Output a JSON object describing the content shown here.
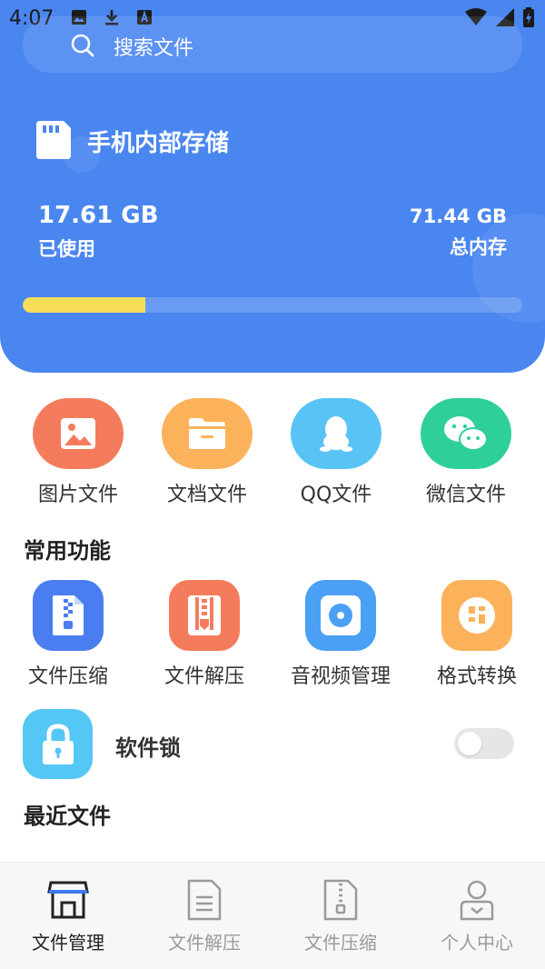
{
  "status_bar": {
    "time": "4:07"
  },
  "search": {
    "placeholder": "搜索文件"
  },
  "storage": {
    "title": "手机内部存储",
    "used_value": "17.61 GB",
    "used_label": "已使用",
    "total_value": "71.44 GB",
    "total_label": "总内存",
    "used_fraction": 0.246
  },
  "categories": [
    {
      "label": "图片文件",
      "icon": "image-icon",
      "color": "#f47c5c"
    },
    {
      "label": "文档文件",
      "icon": "folder-icon",
      "color": "#fbb25a"
    },
    {
      "label": "QQ文件",
      "icon": "penguin-icon",
      "color": "#59c3f5"
    },
    {
      "label": "微信文件",
      "icon": "wechat-icon",
      "color": "#2fcf9c"
    }
  ],
  "common_section": {
    "title": "常用功能"
  },
  "tools": [
    {
      "label": "文件压缩",
      "icon": "zip-icon",
      "color": "#4a7df0"
    },
    {
      "label": "文件解压",
      "icon": "unzip-icon",
      "color": "#f47c5c"
    },
    {
      "label": "音视频管理",
      "icon": "media-icon",
      "color": "#4aa0f5"
    },
    {
      "label": "格式转换",
      "icon": "convert-icon",
      "color": "#fbb25a"
    }
  ],
  "app_lock": {
    "label": "软件锁",
    "enabled": false
  },
  "recent_section": {
    "title": "最近文件"
  },
  "bottom_nav": [
    {
      "label": "文件管理",
      "active": true
    },
    {
      "label": "文件解压",
      "active": false
    },
    {
      "label": "文件压缩",
      "active": false
    },
    {
      "label": "个人中心",
      "active": false
    }
  ]
}
